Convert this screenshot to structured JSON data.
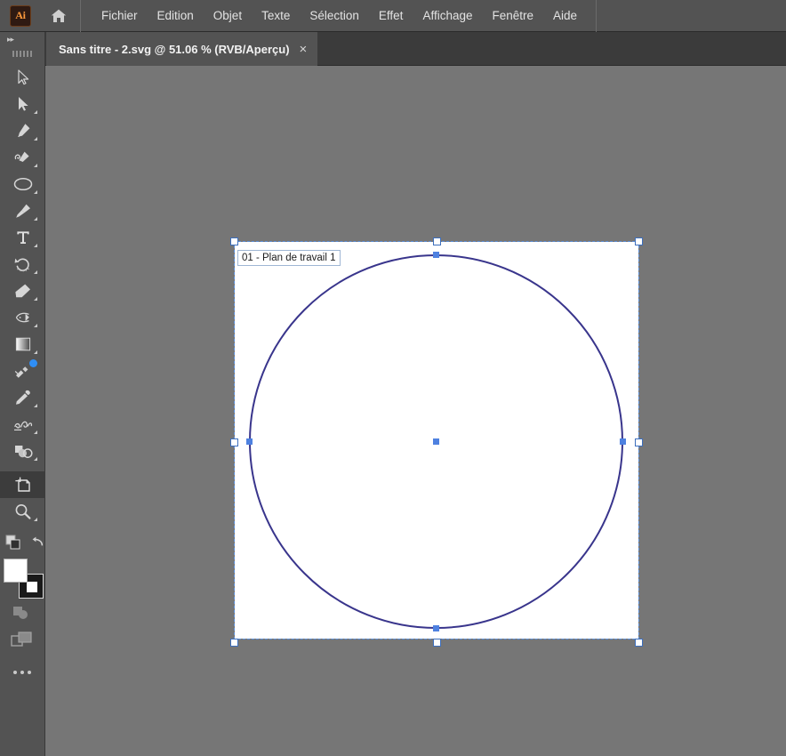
{
  "app": {
    "name": "Adobe Illustrator",
    "logo_text": "Ai",
    "home_icon": "home-icon"
  },
  "menubar": {
    "items": [
      {
        "label": "Fichier"
      },
      {
        "label": "Edition"
      },
      {
        "label": "Objet"
      },
      {
        "label": "Texte"
      },
      {
        "label": "Sélection"
      },
      {
        "label": "Effet"
      },
      {
        "label": "Affichage"
      },
      {
        "label": "Fenêtre"
      },
      {
        "label": "Aide"
      }
    ]
  },
  "tabbar": {
    "document_tab": {
      "title": "Sans titre - 2.svg @ 51.06 % (RVB/Aperçu)",
      "close_label": "×",
      "file_name": "Sans titre - 2.svg",
      "zoom_level": "51.06 %",
      "color_mode": "RVB/Aperçu"
    }
  },
  "toolbar": {
    "collapse_label": "▸▸",
    "tools": [
      {
        "name": "selection-tool",
        "title": "Sélection"
      },
      {
        "name": "direct-selection-tool",
        "title": "Sélection directe"
      },
      {
        "name": "pen-tool",
        "title": "Plume"
      },
      {
        "name": "curvature-tool",
        "title": "Courbure"
      },
      {
        "name": "ellipse-tool",
        "title": "Ellipse"
      },
      {
        "name": "paintbrush-tool",
        "title": "Pinceau"
      },
      {
        "name": "type-tool",
        "title": "Texte"
      },
      {
        "name": "rotate-tool",
        "title": "Rotation"
      },
      {
        "name": "eraser-tool",
        "title": "Gomme"
      },
      {
        "name": "scale-tool",
        "title": "Mise à l'échelle"
      },
      {
        "name": "gradient-tool",
        "title": "Dégradé"
      },
      {
        "name": "free-transform-tool",
        "title": "Transformation manuelle"
      },
      {
        "name": "eyedropper-tool",
        "title": "Pipette"
      },
      {
        "name": "blend-tool",
        "title": "Dégradé de formes"
      },
      {
        "name": "shape-builder-tool",
        "title": "Concepteur de forme"
      },
      {
        "name": "artboard-tool",
        "title": "Plan de travail"
      },
      {
        "name": "zoom-tool",
        "title": "Zoom"
      }
    ],
    "selected_tool": "artboard-tool",
    "fill_color": "#ffffff",
    "stroke_color": "#1a1a1a",
    "more_tools_label": "•••"
  },
  "canvas": {
    "background_color": "#767676",
    "artboard": {
      "label": "01 - Plan de travail 1",
      "fill": "#ffffff",
      "selected": true,
      "border_color": "#5b8dd6"
    },
    "objects": [
      {
        "name": "circle-shape",
        "type": "ellipse",
        "stroke_color": "#39358c",
        "fill": "none",
        "stroke_width": 2
      }
    ],
    "anchor_color": "#4e81e0"
  }
}
